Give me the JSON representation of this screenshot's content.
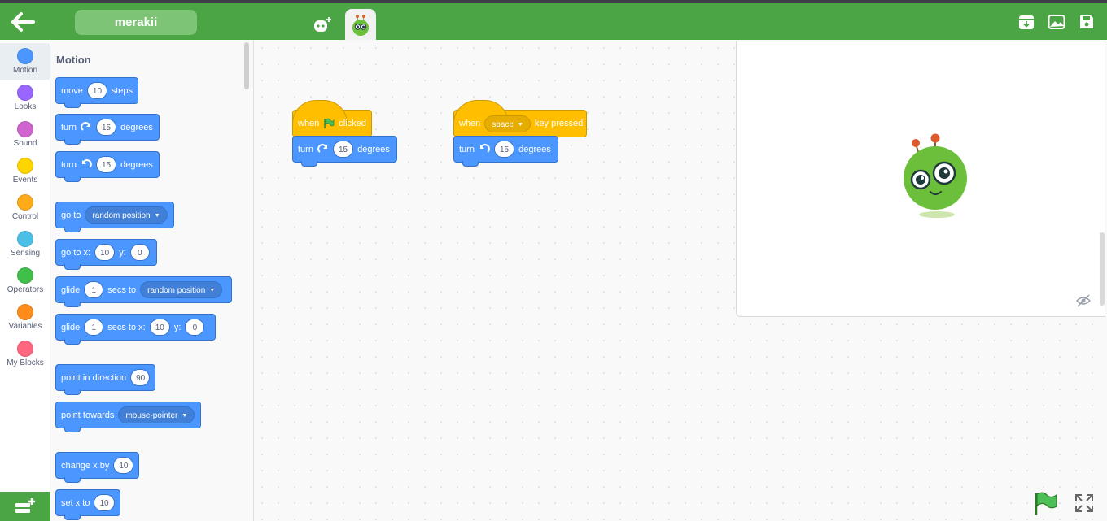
{
  "header": {
    "project_name": "merakii",
    "back_icon": "arrow-left-icon",
    "icons": [
      "add-sprite-icon",
      "sprite-icon",
      "download-icon",
      "backdrop-icon",
      "save-icon"
    ]
  },
  "categories": [
    {
      "label": "Motion",
      "color": "#4c97ff",
      "active": true
    },
    {
      "label": "Looks",
      "color": "#9966ff"
    },
    {
      "label": "Sound",
      "color": "#cf63cf"
    },
    {
      "label": "Events",
      "color": "#ffd500"
    },
    {
      "label": "Control",
      "color": "#ffab19"
    },
    {
      "label": "Sensing",
      "color": "#4cbfe6"
    },
    {
      "label": "Operators",
      "color": "#40bf4a"
    },
    {
      "label": "Variables",
      "color": "#ff8c1a"
    },
    {
      "label": "My Blocks",
      "color": "#ff6680"
    }
  ],
  "palette": {
    "title": "Motion",
    "move": {
      "a": "move",
      "v": "10",
      "b": "steps"
    },
    "turn_right": {
      "a": "turn",
      "v": "15",
      "b": "degrees"
    },
    "turn_left": {
      "a": "turn",
      "v": "15",
      "b": "degrees"
    },
    "go_to": {
      "a": "go to",
      "dd": "random position"
    },
    "go_to_xy": {
      "a": "go to x:",
      "x": "10",
      "b": "y:",
      "y": "0"
    },
    "glide_to": {
      "a": "glide",
      "v": "1",
      "b": "secs to",
      "dd": "random position"
    },
    "glide_xy": {
      "a": "glide",
      "v": "1",
      "b": "secs to x:",
      "x": "10",
      "c": "y:",
      "y": "0"
    },
    "point_dir": {
      "a": "point in direction",
      "v": "90"
    },
    "point_towards": {
      "a": "point towards",
      "dd": "mouse-pointer"
    },
    "change_x": {
      "a": "change x by",
      "v": "10"
    },
    "set_x": {
      "a": "set x to",
      "v": "10"
    }
  },
  "script1": {
    "hat_a": "when",
    "hat_b": "clicked",
    "turn_a": "turn",
    "turn_v": "15",
    "turn_b": "degrees"
  },
  "script2": {
    "hat_a": "when",
    "hat_key": "space",
    "hat_b": "key pressed",
    "turn_a": "turn",
    "turn_v": "15",
    "turn_b": "degrees"
  },
  "colors": {
    "brand_green": "#4ca545",
    "motion": "#4c97ff",
    "events": "#ffbf00"
  }
}
